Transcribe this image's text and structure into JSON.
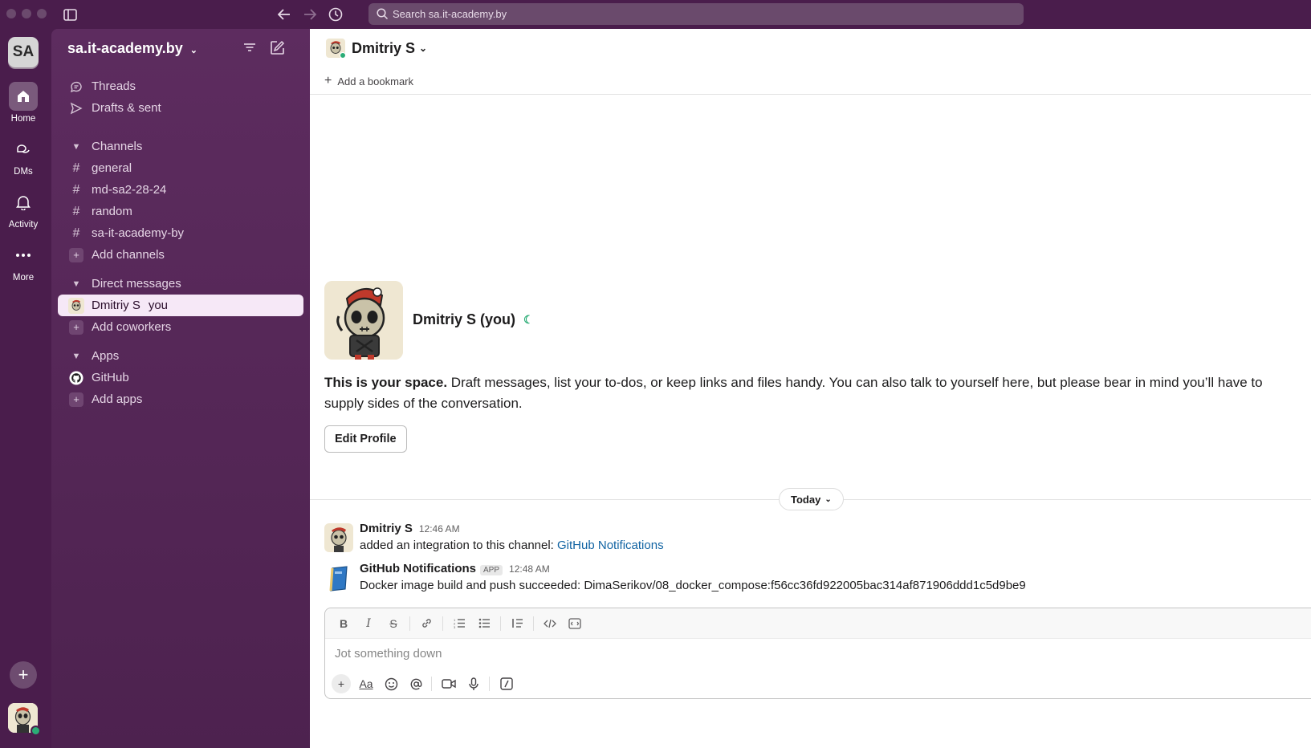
{
  "titlebar": {
    "search_placeholder": "Search sa.it-academy.by"
  },
  "rail": {
    "workspace_initials": "SA",
    "items": [
      {
        "label": "Home",
        "icon": "home-icon"
      },
      {
        "label": "DMs",
        "icon": "dm-icon"
      },
      {
        "label": "Activity",
        "icon": "bell-icon"
      },
      {
        "label": "More",
        "icon": "more-icon"
      }
    ]
  },
  "sidebar": {
    "workspace_name": "sa.it-academy.by",
    "top_items": [
      {
        "label": "Threads",
        "icon": "threads-icon"
      },
      {
        "label": "Drafts & sent",
        "icon": "send-icon"
      }
    ],
    "channels_header": "Channels",
    "channels": [
      "general",
      "md-sa2-28-24",
      "random",
      "sa-it-academy-by"
    ],
    "add_channels": "Add channels",
    "dm_header": "Direct messages",
    "dm_user": "Dmitriy S",
    "dm_you": "you",
    "add_coworkers": "Add coworkers",
    "apps_header": "Apps",
    "apps": [
      "GitHub"
    ],
    "add_apps": "Add apps"
  },
  "channel": {
    "title": "Dmitriy S",
    "add_bookmark": "Add a bookmark"
  },
  "intro": {
    "name": "Dmitriy S (you)",
    "text_bold": "This is your space.",
    "text_rest": " Draft messages, list your to-dos, or keep links and files handy. You can also talk to yourself here, but please bear in mind you’ll have to supply sides of the conversation.",
    "edit_profile": "Edit Profile"
  },
  "divider": {
    "label": "Today"
  },
  "messages": [
    {
      "name": "Dmitriy S",
      "time": "12:46 AM",
      "body_text": "added an integration to this channel: ",
      "body_link": "GitHub Notifications"
    },
    {
      "name": "GitHub Notifications",
      "app_tag": "APP",
      "time": "12:48 AM",
      "body_text": "Docker image build and push succeeded: DimaSerikov/08_docker_compose:f56cc36fd922005bac314af871906ddd1c5d9be9"
    }
  ],
  "composer": {
    "placeholder": "Jot something down"
  },
  "colors": {
    "aubergine": "#4a1d4c",
    "sidebar": "#5d2c5f",
    "selected": "#f6e8f7",
    "link": "#1264a3",
    "presence": "#2bac76"
  }
}
